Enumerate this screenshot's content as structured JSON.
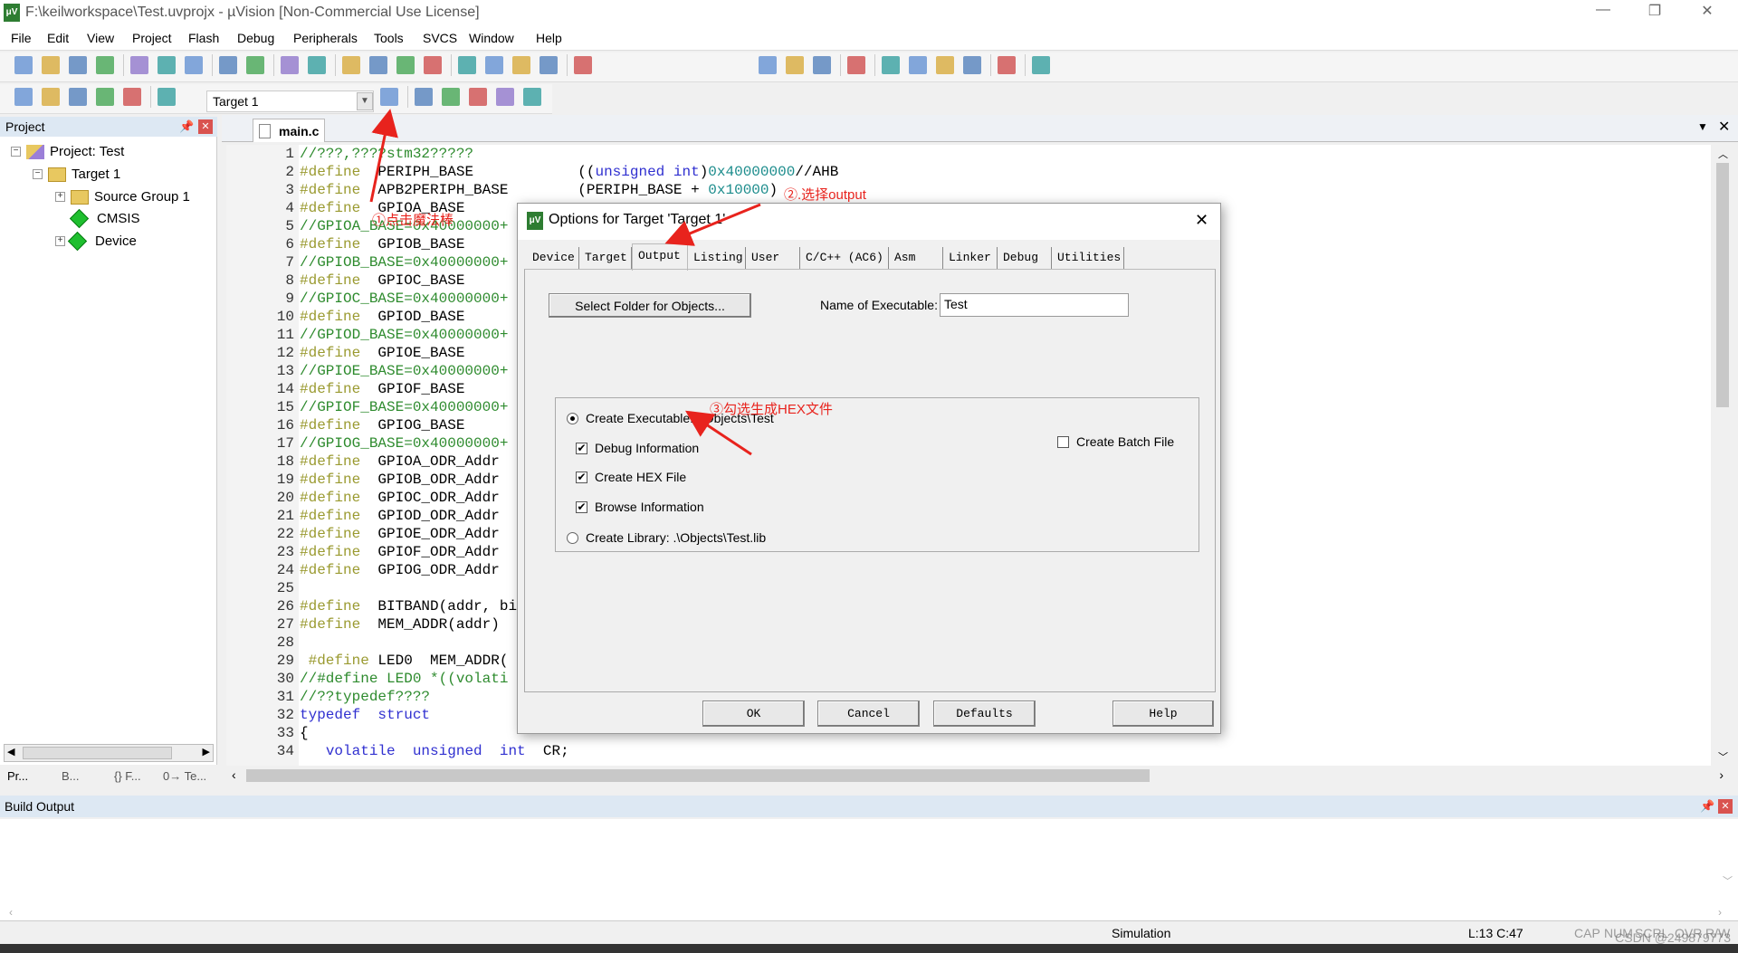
{
  "window": {
    "title": "F:\\keilworkspace\\Test.uvprojx - µVision  [Non-Commercial Use License]",
    "app_icon": "keil-uvision-icon",
    "controls": {
      "minimize": "—",
      "restore": "❐",
      "close": "✕"
    }
  },
  "menu": [
    "File",
    "Edit",
    "View",
    "Project",
    "Flash",
    "Debug",
    "Peripherals",
    "Tools",
    "SVCS",
    "Window",
    "Help"
  ],
  "toolbar1": [
    "new-file",
    "open-file",
    "save",
    "save-all",
    "|",
    "cut",
    "copy",
    "paste",
    "|",
    "undo",
    "redo",
    "|",
    "nav-back",
    "nav-forward",
    "|",
    "bookmark",
    "prev-bookmark",
    "next-bookmark",
    "clear-bookmarks",
    "|",
    "indent",
    "unindent",
    "comment",
    "uncomment",
    "|",
    "find-in-files"
  ],
  "toolbar1_right": [
    "find-dropdown",
    "incremental-find",
    "find",
    "|",
    "debug-session",
    "|",
    "breakpoint",
    "breakpoint-disable",
    "breakpoint-kill-all",
    "breakpoint-clear",
    "|",
    "window-layout",
    "|",
    "configure"
  ],
  "toolbar2": [
    "translate",
    "build",
    "rebuild",
    "batch-build",
    "stop-build",
    "|",
    "download"
  ],
  "toolbar2_right": [
    "options-for-target",
    "|",
    "manage-project-items",
    "select-packs",
    "manage-rte",
    "pack-installer",
    "software-packs"
  ],
  "target_select": "Target 1",
  "project_panel": {
    "title": "Project",
    "tree": [
      {
        "label": "Project: Test",
        "icon": "project-icon",
        "expander": "−"
      },
      {
        "label": "Target 1",
        "icon": "target-folder-icon",
        "expander": "−"
      },
      {
        "label": "Source Group 1",
        "icon": "folder-icon",
        "expander": "+"
      },
      {
        "label": "CMSIS",
        "icon": "component-icon",
        "expander": ""
      },
      {
        "label": "Device",
        "icon": "component-icon",
        "expander": "+"
      }
    ],
    "tabs": [
      "Pr...",
      "B...",
      "{} F...",
      "0→ Te..."
    ]
  },
  "editor": {
    "tab": "main.c",
    "lines": [
      [
        [
          "cm",
          "//???,????stm32?????"
        ]
      ],
      [
        [
          "pp",
          "#define"
        ],
        [
          "",
          "  PERIPH_BASE            "
        ],
        [
          "",
          "(("
        ],
        [
          "kw",
          "unsigned int"
        ],
        [
          "",
          ")"
        ],
        [
          "nm",
          "0x40000000"
        ],
        [
          "",
          "//AHB"
        ]
      ],
      [
        [
          "pp",
          "#define"
        ],
        [
          "",
          "  APB2PERIPH_BASE        "
        ],
        [
          "",
          "(PERIPH_BASE + "
        ],
        [
          "nm",
          "0x10000"
        ],
        [
          "",
          ")"
        ]
      ],
      [
        [
          "pp",
          "#define"
        ],
        [
          "",
          "  GPIOA_BASE"
        ]
      ],
      [
        [
          "cm",
          "//GPIOA_BASE=0x40000000+"
        ]
      ],
      [
        [
          "pp",
          "#define"
        ],
        [
          "",
          "  GPIOB_BASE"
        ]
      ],
      [
        [
          "cm",
          "//GPIOB_BASE=0x40000000+"
        ]
      ],
      [
        [
          "pp",
          "#define"
        ],
        [
          "",
          "  GPIOC_BASE"
        ]
      ],
      [
        [
          "cm",
          "//GPIOC_BASE=0x40000000+"
        ]
      ],
      [
        [
          "pp",
          "#define"
        ],
        [
          "",
          "  GPIOD_BASE"
        ]
      ],
      [
        [
          "cm",
          "//GPIOD_BASE=0x40000000+"
        ]
      ],
      [
        [
          "pp",
          "#define"
        ],
        [
          "",
          "  GPIOE_BASE"
        ]
      ],
      [
        [
          "cm",
          "//GPIOE_BASE=0x40000000+"
        ]
      ],
      [
        [
          "pp",
          "#define"
        ],
        [
          "",
          "  GPIOF_BASE"
        ]
      ],
      [
        [
          "cm",
          "//GPIOF_BASE=0x40000000+"
        ]
      ],
      [
        [
          "pp",
          "#define"
        ],
        [
          "",
          "  GPIOG_BASE"
        ]
      ],
      [
        [
          "cm",
          "//GPIOG_BASE=0x40000000+"
        ]
      ],
      [
        [
          "pp",
          "#define"
        ],
        [
          "",
          "  GPIOA_ODR_Addr"
        ]
      ],
      [
        [
          "pp",
          "#define"
        ],
        [
          "",
          "  GPIOB_ODR_Addr"
        ]
      ],
      [
        [
          "pp",
          "#define"
        ],
        [
          "",
          "  GPIOC_ODR_Addr"
        ]
      ],
      [
        [
          "pp",
          "#define"
        ],
        [
          "",
          "  GPIOD_ODR_Addr"
        ]
      ],
      [
        [
          "pp",
          "#define"
        ],
        [
          "",
          "  GPIOE_ODR_Addr"
        ]
      ],
      [
        [
          "pp",
          "#define"
        ],
        [
          "",
          "  GPIOF_ODR_Addr"
        ]
      ],
      [
        [
          "pp",
          "#define"
        ],
        [
          "",
          "  GPIOG_ODR_Addr"
        ]
      ],
      [],
      [
        [
          "pp",
          "#define"
        ],
        [
          "",
          "  BITBAND(addr, bi"
        ]
      ],
      [
        [
          "pp",
          "#define"
        ],
        [
          "",
          "  MEM_ADDR(addr)"
        ]
      ],
      [],
      [
        [
          "",
          ""
        ],
        [
          "pp",
          " #define"
        ],
        [
          "",
          " LED0  MEM_ADDR("
        ]
      ],
      [
        [
          "cm",
          "//#define LED0 *((volati"
        ]
      ],
      [
        [
          "cm",
          "//??typedef????"
        ]
      ],
      [
        [
          "kw",
          "typedef  struct"
        ]
      ],
      [
        [
          "",
          "{"
        ]
      ],
      [
        [
          "",
          "   "
        ],
        [
          "kw",
          "volatile  unsigned  int"
        ],
        [
          "",
          "  CR;"
        ]
      ]
    ]
  },
  "build_output": {
    "title": "Build Output"
  },
  "status": {
    "mode": "Simulation",
    "position": "L:13 C:47",
    "indicators": [
      "CAP",
      "NUM",
      "SCRL",
      "OVR",
      "R/W"
    ]
  },
  "watermark": "CSDN @249879773",
  "dialog": {
    "title": "Options for Target 'Target 1'",
    "close": "✕",
    "tabs": [
      "Device",
      "Target",
      "Output",
      "Listing",
      "User",
      "C/C++ (AC6)",
      "Asm",
      "Linker",
      "Debug",
      "Utilities"
    ],
    "active_tab": "Output",
    "select_folder_button": "Select Folder for Objects...",
    "name_label": "Name of Executable:",
    "name_value": "Test",
    "create_executable": {
      "label": "Create Executable:  .\\Objects\\Test",
      "selected": true
    },
    "debug_info": {
      "label": "Debug Information",
      "checked": true
    },
    "create_hex": {
      "label": "Create HEX File",
      "checked": true
    },
    "browse_info": {
      "label": "Browse Information",
      "checked": true
    },
    "create_library": {
      "label": "Create Library:  .\\Objects\\Test.lib",
      "selected": false
    },
    "create_batch": {
      "label": "Create Batch File",
      "checked": false
    },
    "buttons": {
      "ok": "OK",
      "cancel": "Cancel",
      "defaults": "Defaults",
      "help": "Help"
    }
  },
  "annotations": {
    "step1": "①点击魔法棒",
    "step2": "②.选择output",
    "step3": "③勾选生成HEX文件",
    "color": "#e8231d"
  }
}
